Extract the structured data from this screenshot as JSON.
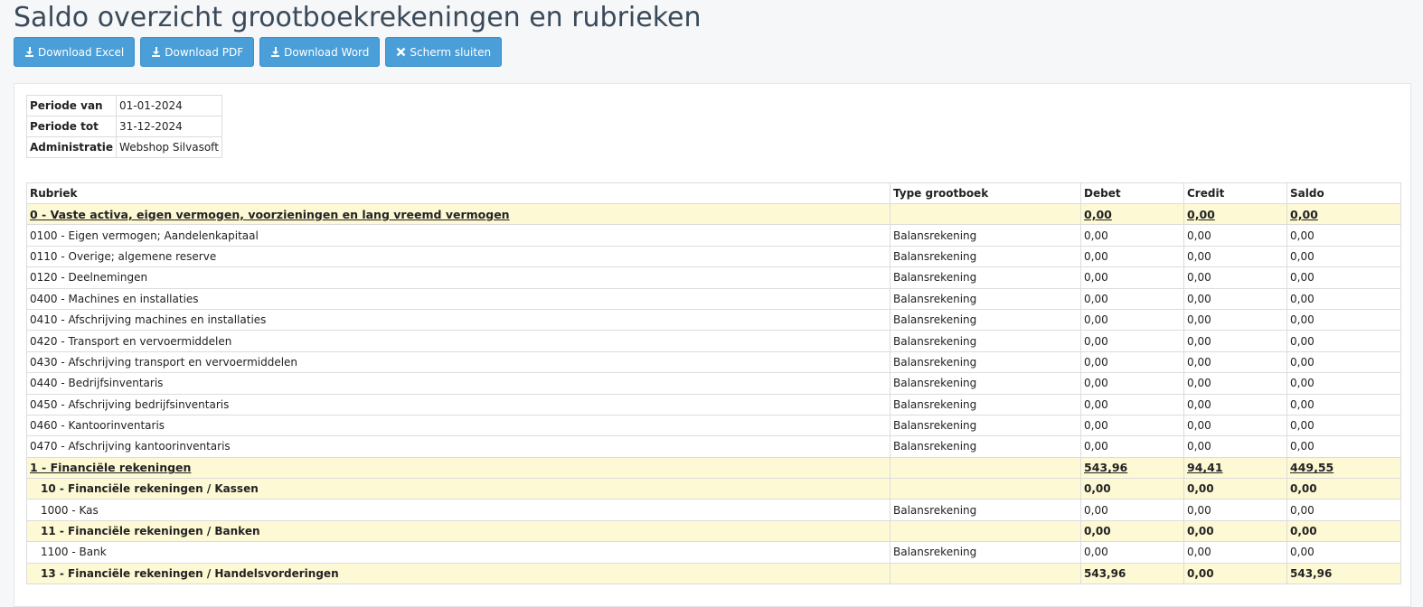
{
  "page": {
    "title": "Saldo overzicht grootboekrekeningen en rubrieken"
  },
  "toolbar": {
    "excel": "Download Excel",
    "pdf": "Download PDF",
    "word": "Download Word",
    "close": "Scherm sluiten"
  },
  "meta": [
    {
      "label": "Periode van",
      "value": "01-01-2024"
    },
    {
      "label": "Periode tot",
      "value": "31-12-2024"
    },
    {
      "label": "Administratie",
      "value": "Webshop Silvasoft"
    }
  ],
  "table": {
    "headers": {
      "rubriek": "Rubriek",
      "type": "Type grootboek",
      "debet": "Debet",
      "credit": "Credit",
      "saldo": "Saldo"
    },
    "rows": [
      {
        "kind": "lvl0",
        "name": "0 - Vaste activa, eigen vermogen, voorzieningen en lang vreemd vermogen",
        "type": "",
        "debet": "0,00",
        "credit": "0,00",
        "saldo": "0,00"
      },
      {
        "kind": "acc",
        "name": "0100 - Eigen vermogen; Aandelenkapitaal",
        "type": "Balansrekening",
        "debet": "0,00",
        "credit": "0,00",
        "saldo": "0,00"
      },
      {
        "kind": "acc",
        "name": "0110 - Overige; algemene reserve",
        "type": "Balansrekening",
        "debet": "0,00",
        "credit": "0,00",
        "saldo": "0,00"
      },
      {
        "kind": "acc",
        "name": "0120 - Deelnemingen",
        "type": "Balansrekening",
        "debet": "0,00",
        "credit": "0,00",
        "saldo": "0,00"
      },
      {
        "kind": "acc",
        "name": "0400 - Machines en installaties",
        "type": "Balansrekening",
        "debet": "0,00",
        "credit": "0,00",
        "saldo": "0,00"
      },
      {
        "kind": "acc",
        "name": "0410 - Afschrijving machines en installaties",
        "type": "Balansrekening",
        "debet": "0,00",
        "credit": "0,00",
        "saldo": "0,00"
      },
      {
        "kind": "acc",
        "name": "0420 - Transport en vervoermiddelen",
        "type": "Balansrekening",
        "debet": "0,00",
        "credit": "0,00",
        "saldo": "0,00"
      },
      {
        "kind": "acc",
        "name": "0430 - Afschrijving transport en vervoermiddelen",
        "type": "Balansrekening",
        "debet": "0,00",
        "credit": "0,00",
        "saldo": "0,00"
      },
      {
        "kind": "acc",
        "name": "0440 - Bedrijfsinventaris",
        "type": "Balansrekening",
        "debet": "0,00",
        "credit": "0,00",
        "saldo": "0,00"
      },
      {
        "kind": "acc",
        "name": "0450 - Afschrijving bedrijfsinventaris",
        "type": "Balansrekening",
        "debet": "0,00",
        "credit": "0,00",
        "saldo": "0,00"
      },
      {
        "kind": "acc",
        "name": "0460 - Kantoorinventaris",
        "type": "Balansrekening",
        "debet": "0,00",
        "credit": "0,00",
        "saldo": "0,00"
      },
      {
        "kind": "acc",
        "name": "0470 - Afschrijving kantoorinventaris",
        "type": "Balansrekening",
        "debet": "0,00",
        "credit": "0,00",
        "saldo": "0,00"
      },
      {
        "kind": "lvl0",
        "name": "1 - Financiële rekeningen",
        "type": "",
        "debet": "543,96",
        "credit": "94,41",
        "saldo": "449,55"
      },
      {
        "kind": "lvl1",
        "name": "10 - Financiële rekeningen / Kassen",
        "type": "",
        "debet": "0,00",
        "credit": "0,00",
        "saldo": "0,00"
      },
      {
        "kind": "acc sub",
        "name": "1000 - Kas",
        "type": "Balansrekening",
        "debet": "0,00",
        "credit": "0,00",
        "saldo": "0,00"
      },
      {
        "kind": "lvl1",
        "name": "11 - Financiële rekeningen / Banken",
        "type": "",
        "debet": "0,00",
        "credit": "0,00",
        "saldo": "0,00"
      },
      {
        "kind": "acc sub",
        "name": "1100 - Bank",
        "type": "Balansrekening",
        "debet": "0,00",
        "credit": "0,00",
        "saldo": "0,00"
      },
      {
        "kind": "lvl1",
        "name": "13 - Financiële rekeningen / Handelsvorderingen",
        "type": "",
        "debet": "543,96",
        "credit": "0,00",
        "saldo": "543,96"
      }
    ]
  }
}
